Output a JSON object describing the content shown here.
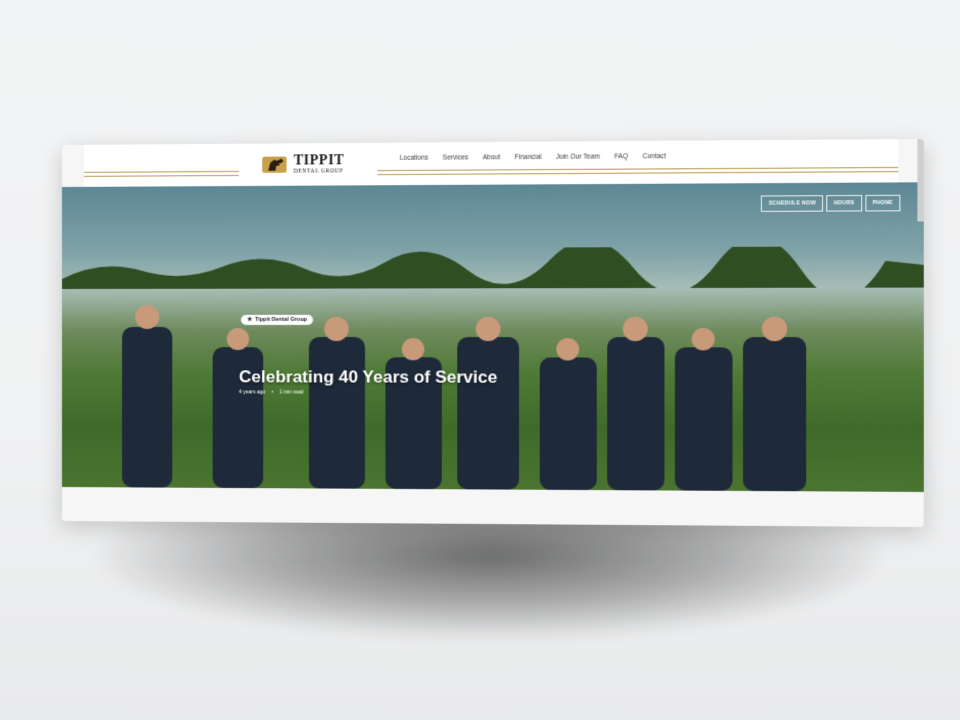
{
  "brand": {
    "title": "TIPPIT",
    "subtitle": "DENTAL GROUP",
    "colors": {
      "gold": "#b89a56",
      "text": "#1a1a1a"
    }
  },
  "nav": {
    "items": [
      "Locations",
      "Services",
      "About",
      "Financial",
      "Join Our Team",
      "FAQ",
      "Contact"
    ]
  },
  "hero": {
    "buttons": [
      "SCHEDULE NOW",
      "HOURS",
      "PHONE"
    ],
    "tag": "Tippit Dental Group",
    "title": "Celebrating 40 Years of Service",
    "meta": [
      "4 years ago",
      "•",
      "1 min read"
    ]
  }
}
